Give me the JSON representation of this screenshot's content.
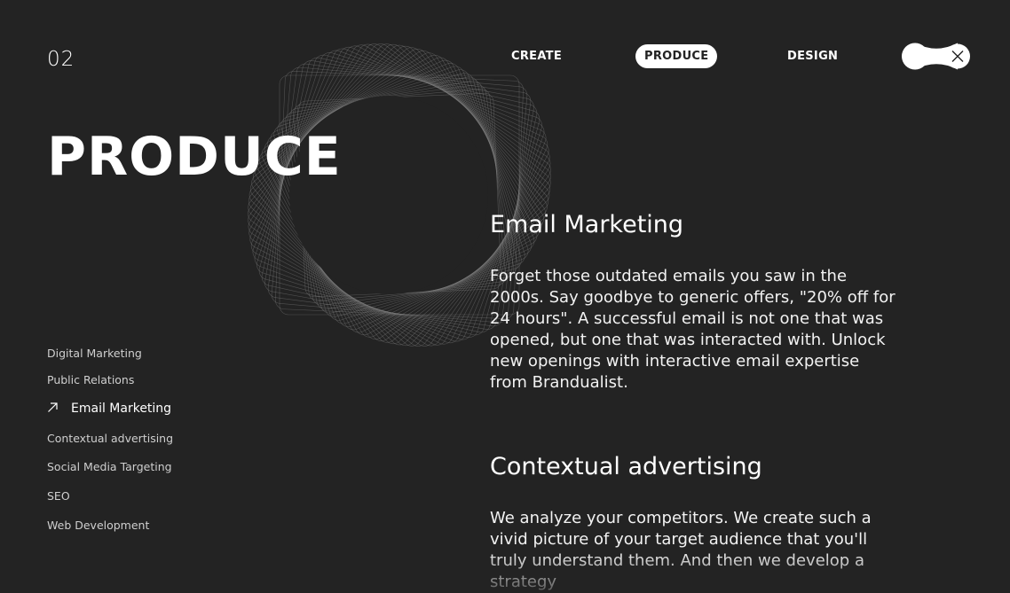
{
  "page_number": "02",
  "nav": {
    "items": [
      {
        "label": "CREATE",
        "active": false
      },
      {
        "label": "PRODUCE",
        "active": true
      },
      {
        "label": "DESIGN",
        "active": false
      }
    ]
  },
  "hero": {
    "title": "PRODUCE"
  },
  "sidebar": {
    "items": [
      {
        "label": "Digital Marketing",
        "active": false
      },
      {
        "label": "Public Relations",
        "active": false
      },
      {
        "label": "Email Marketing",
        "active": true
      },
      {
        "label": "Contextual advertising",
        "active": false
      },
      {
        "label": "Social Media Targeting",
        "active": false
      },
      {
        "label": "SEO",
        "active": false
      },
      {
        "label": "Web Development",
        "active": false
      }
    ]
  },
  "sections": [
    {
      "title": "Email Marketing",
      "text": "Forget those outdated emails you saw in the 2000s. Say goodbye to generic offers, \"20% off for 24 hours\". A successful email is not one that was opened, but one that was interacted with. Unlock new openings with interactive email expertise from Brandualist."
    },
    {
      "title": "Contextual advertising",
      "text": "We analyze your competitors. We create such a vivid picture of your target audience that you'll truly understand them. And then we develop a strategy"
    }
  ],
  "colors": {
    "background": "#232323",
    "text": "#ffffff",
    "muted": "#cfcfcf"
  },
  "icons": {
    "toggle": "close-icon",
    "active_item": "arrow-up-right-icon"
  }
}
